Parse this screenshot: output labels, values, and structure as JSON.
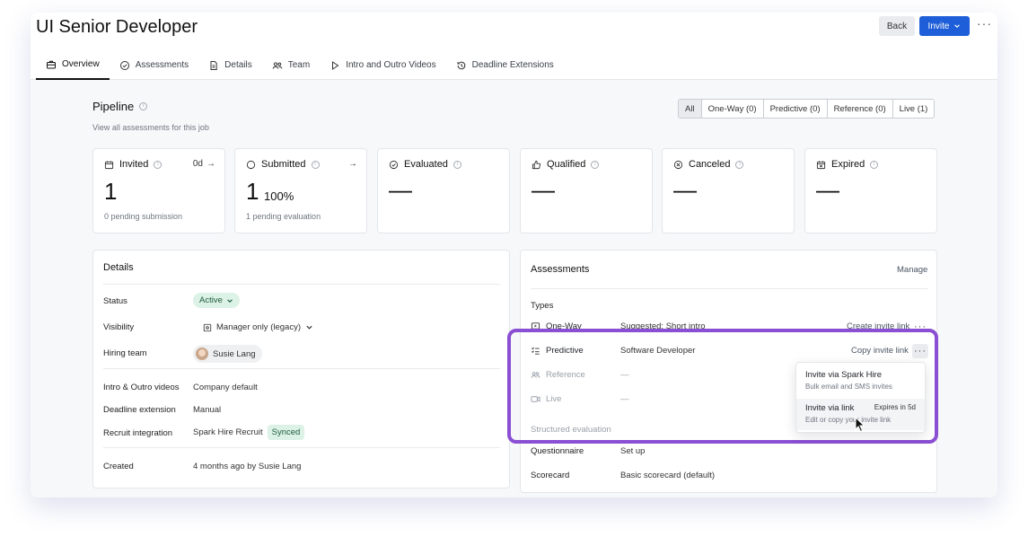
{
  "header": {
    "title": "UI Senior Developer",
    "back_label": "Back",
    "invite_label": "Invite",
    "more_label": "···"
  },
  "tabs": [
    {
      "label": "Overview",
      "icon": "briefcase-icon",
      "active": true
    },
    {
      "label": "Assessments",
      "icon": "check-circle-icon"
    },
    {
      "label": "Details",
      "icon": "document-icon"
    },
    {
      "label": "Team",
      "icon": "people-icon"
    },
    {
      "label": "Intro and Outro Videos",
      "icon": "play-icon"
    },
    {
      "label": "Deadline Extensions",
      "icon": "history-icon"
    }
  ],
  "pipeline": {
    "title": "Pipeline",
    "subtitle": "View all assessments for this job",
    "filters": [
      "All",
      "One-Way (0)",
      "Predictive (0)",
      "Reference (0)",
      "Live (1)"
    ],
    "selected_filter": "All"
  },
  "cards": [
    {
      "title": "Invited",
      "right": "0d",
      "value": "1",
      "footer": "0 pending submission",
      "icon": "calendar-icon"
    },
    {
      "title": "Submitted",
      "right": "",
      "value": "1",
      "pct": "100%",
      "footer": "1 pending evaluation",
      "icon": "circle-icon"
    },
    {
      "title": "Evaluated",
      "value": "—",
      "icon": "check-circle-icon"
    },
    {
      "title": "Qualified",
      "value": "—",
      "icon": "thumbs-up-icon"
    },
    {
      "title": "Canceled",
      "value": "—",
      "icon": "x-circle-icon"
    },
    {
      "title": "Expired",
      "value": "—",
      "icon": "calendar-x-icon"
    }
  ],
  "details": {
    "title": "Details",
    "rows": [
      {
        "label": "Status",
        "value": "Active"
      },
      {
        "label": "Visibility",
        "value": "Manager only (legacy)"
      },
      {
        "label": "Hiring team",
        "value": "Susie Lang"
      },
      {
        "label": "Intro & Outro videos",
        "value": "Company default"
      },
      {
        "label": "Deadline extension",
        "value": "Manual"
      },
      {
        "label": "Recruit integration",
        "value": "Spark Hire Recruit",
        "badge": "Synced"
      },
      {
        "label": "Created",
        "value": "4 months ago by Susie Lang"
      }
    ]
  },
  "assessments": {
    "title": "Assessments",
    "manage_label": "Manage",
    "types_label": "Types",
    "types": [
      {
        "name": "One-Way",
        "value": "Suggested: Short intro",
        "action": "Create invite link"
      },
      {
        "name": "Predictive",
        "value": "Software Developer",
        "action": "Copy invite link"
      },
      {
        "name": "Reference",
        "value": "—"
      },
      {
        "name": "Live",
        "value": "—"
      }
    ],
    "structured_label": "Structured evaluation",
    "questionnaire_label": "Questionnaire",
    "questionnaire_value": "Set up",
    "scorecard_label": "Scorecard",
    "scorecard_value": "Basic scorecard (default)"
  },
  "dropdown": {
    "item1_title": "Invite via Spark Hire",
    "item1_sub": "Bulk email and SMS invites",
    "item2_title": "Invite via link",
    "item2_badge": "Expires in 5d",
    "item2_sub": "Edit or copy your invite link"
  },
  "colors": {
    "primary": "#1e5ed8",
    "highlight": "#8a4fd3",
    "active_green": "#dcf2e6"
  }
}
